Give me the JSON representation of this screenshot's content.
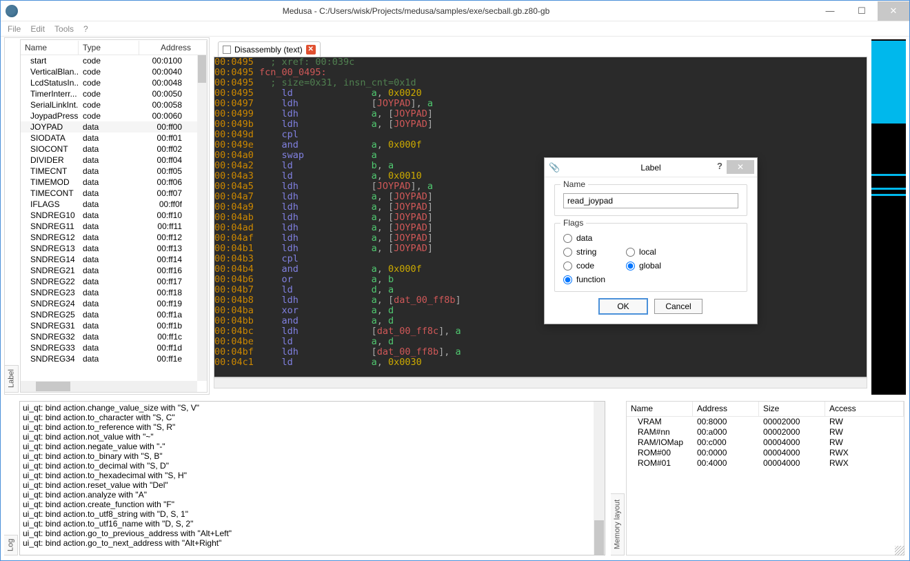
{
  "window": {
    "title": "Medusa - C:/Users/wisk/Projects/medusa/samples/exe/secball.gb.z80-gb"
  },
  "menubar": [
    "File",
    "Edit",
    "Tools",
    "?"
  ],
  "label_panel": {
    "tab_label": "Label",
    "columns": {
      "name": "Name",
      "type": "Type",
      "address": "Address"
    },
    "selected_index": 6,
    "rows": [
      {
        "name": "start",
        "type": "code",
        "addr": "00:0100"
      },
      {
        "name": "VerticalBlan..",
        "type": "code",
        "addr": "00:0040"
      },
      {
        "name": "LcdStatusIn...",
        "type": "code",
        "addr": "00:0048"
      },
      {
        "name": "TimerInterr...",
        "type": "code",
        "addr": "00:0050"
      },
      {
        "name": "SerialLinkInt...",
        "type": "code",
        "addr": "00:0058"
      },
      {
        "name": "JoypadPress...",
        "type": "code",
        "addr": "00:0060"
      },
      {
        "name": "JOYPAD",
        "type": "data",
        "addr": "00:ff00"
      },
      {
        "name": "SIODATA",
        "type": "data",
        "addr": "00:ff01"
      },
      {
        "name": "SIOCONT",
        "type": "data",
        "addr": "00:ff02"
      },
      {
        "name": "DIVIDER",
        "type": "data",
        "addr": "00:ff04"
      },
      {
        "name": "TIMECNT",
        "type": "data",
        "addr": "00:ff05"
      },
      {
        "name": "TIMEMOD",
        "type": "data",
        "addr": "00:ff06"
      },
      {
        "name": "TIMECONT",
        "type": "data",
        "addr": "00:ff07"
      },
      {
        "name": "IFLAGS",
        "type": "data",
        "addr": "00:ff0f"
      },
      {
        "name": "SNDREG10",
        "type": "data",
        "addr": "00:ff10"
      },
      {
        "name": "SNDREG11",
        "type": "data",
        "addr": "00:ff11"
      },
      {
        "name": "SNDREG12",
        "type": "data",
        "addr": "00:ff12"
      },
      {
        "name": "SNDREG13",
        "type": "data",
        "addr": "00:ff13"
      },
      {
        "name": "SNDREG14",
        "type": "data",
        "addr": "00:ff14"
      },
      {
        "name": "SNDREG21",
        "type": "data",
        "addr": "00:ff16"
      },
      {
        "name": "SNDREG22",
        "type": "data",
        "addr": "00:ff17"
      },
      {
        "name": "SNDREG23",
        "type": "data",
        "addr": "00:ff18"
      },
      {
        "name": "SNDREG24",
        "type": "data",
        "addr": "00:ff19"
      },
      {
        "name": "SNDREG25",
        "type": "data",
        "addr": "00:ff1a"
      },
      {
        "name": "SNDREG31",
        "type": "data",
        "addr": "00:ff1b"
      },
      {
        "name": "SNDREG32",
        "type": "data",
        "addr": "00:ff1c"
      },
      {
        "name": "SNDREG33",
        "type": "data",
        "addr": "00:ff1d"
      },
      {
        "name": "SNDREG34",
        "type": "data",
        "addr": "00:ff1e"
      }
    ]
  },
  "disasm_tab": {
    "label": "Disassembly (text)"
  },
  "disasm_lines": [
    [
      [
        "addr",
        "00:0495"
      ],
      [
        "pun",
        "   "
      ],
      [
        "cmt",
        "; xref: 00:039c"
      ]
    ],
    [
      [
        "addr",
        "00:0495"
      ],
      [
        "pun",
        " "
      ],
      [
        "lbl",
        "fcn_00_0495"
      ],
      [
        "lbl",
        ":"
      ]
    ],
    [
      [
        "addr",
        "00:0495"
      ],
      [
        "pun",
        "   "
      ],
      [
        "cmt",
        "; size=0x31, insn_cnt=0x1d"
      ]
    ],
    [
      [
        "addr",
        "00:0495"
      ],
      [
        "pun",
        "     "
      ],
      [
        "mne",
        "ld"
      ],
      [
        "pun",
        "              "
      ],
      [
        "reg",
        "a"
      ],
      [
        "pun",
        ", "
      ],
      [
        "imm",
        "0x0020"
      ]
    ],
    [
      [
        "addr",
        "00:0497"
      ],
      [
        "pun",
        "     "
      ],
      [
        "mne",
        "ldh"
      ],
      [
        "pun",
        "             "
      ],
      [
        "pun",
        "["
      ],
      [
        "ref",
        "JOYPAD"
      ],
      [
        "pun",
        "], "
      ],
      [
        "reg",
        "a"
      ]
    ],
    [
      [
        "addr",
        "00:0499"
      ],
      [
        "pun",
        "     "
      ],
      [
        "mne",
        "ldh"
      ],
      [
        "pun",
        "             "
      ],
      [
        "reg",
        "a"
      ],
      [
        "pun",
        ", ["
      ],
      [
        "ref",
        "JOYPAD"
      ],
      [
        "pun",
        "]"
      ]
    ],
    [
      [
        "addr",
        "00:049b"
      ],
      [
        "pun",
        "     "
      ],
      [
        "mne",
        "ldh"
      ],
      [
        "pun",
        "             "
      ],
      [
        "reg",
        "a"
      ],
      [
        "pun",
        ", ["
      ],
      [
        "ref",
        "JOYPAD"
      ],
      [
        "pun",
        "]"
      ]
    ],
    [
      [
        "addr",
        "00:049d"
      ],
      [
        "pun",
        "     "
      ],
      [
        "mne",
        "cpl"
      ]
    ],
    [
      [
        "addr",
        "00:049e"
      ],
      [
        "pun",
        "     "
      ],
      [
        "mne",
        "and"
      ],
      [
        "pun",
        "             "
      ],
      [
        "reg",
        "a"
      ],
      [
        "pun",
        ", "
      ],
      [
        "imm",
        "0x000f"
      ]
    ],
    [
      [
        "addr",
        "00:04a0"
      ],
      [
        "pun",
        "     "
      ],
      [
        "mne",
        "swap"
      ],
      [
        "pun",
        "            "
      ],
      [
        "reg",
        "a"
      ]
    ],
    [
      [
        "addr",
        "00:04a2"
      ],
      [
        "pun",
        "     "
      ],
      [
        "mne",
        "ld"
      ],
      [
        "pun",
        "              "
      ],
      [
        "reg",
        "b"
      ],
      [
        "pun",
        ", "
      ],
      [
        "reg",
        "a"
      ]
    ],
    [
      [
        "addr",
        "00:04a3"
      ],
      [
        "pun",
        "     "
      ],
      [
        "mne",
        "ld"
      ],
      [
        "pun",
        "              "
      ],
      [
        "reg",
        "a"
      ],
      [
        "pun",
        ", "
      ],
      [
        "imm",
        "0x0010"
      ]
    ],
    [
      [
        "addr",
        "00:04a5"
      ],
      [
        "pun",
        "     "
      ],
      [
        "mne",
        "ldh"
      ],
      [
        "pun",
        "             "
      ],
      [
        "pun",
        "["
      ],
      [
        "ref",
        "JOYPAD"
      ],
      [
        "pun",
        "], "
      ],
      [
        "reg",
        "a"
      ]
    ],
    [
      [
        "addr",
        "00:04a7"
      ],
      [
        "pun",
        "     "
      ],
      [
        "mne",
        "ldh"
      ],
      [
        "pun",
        "             "
      ],
      [
        "reg",
        "a"
      ],
      [
        "pun",
        ", ["
      ],
      [
        "ref",
        "JOYPAD"
      ],
      [
        "pun",
        "]"
      ]
    ],
    [
      [
        "addr",
        "00:04a9"
      ],
      [
        "pun",
        "     "
      ],
      [
        "mne",
        "ldh"
      ],
      [
        "pun",
        "             "
      ],
      [
        "reg",
        "a"
      ],
      [
        "pun",
        ", ["
      ],
      [
        "ref",
        "JOYPAD"
      ],
      [
        "pun",
        "]"
      ]
    ],
    [
      [
        "addr",
        "00:04ab"
      ],
      [
        "pun",
        "     "
      ],
      [
        "mne",
        "ldh"
      ],
      [
        "pun",
        "             "
      ],
      [
        "reg",
        "a"
      ],
      [
        "pun",
        ", ["
      ],
      [
        "ref",
        "JOYPAD"
      ],
      [
        "pun",
        "]"
      ]
    ],
    [
      [
        "addr",
        "00:04ad"
      ],
      [
        "pun",
        "     "
      ],
      [
        "mne",
        "ldh"
      ],
      [
        "pun",
        "             "
      ],
      [
        "reg",
        "a"
      ],
      [
        "pun",
        ", ["
      ],
      [
        "ref",
        "JOYPAD"
      ],
      [
        "pun",
        "]"
      ]
    ],
    [
      [
        "addr",
        "00:04af"
      ],
      [
        "pun",
        "     "
      ],
      [
        "mne",
        "ldh"
      ],
      [
        "pun",
        "             "
      ],
      [
        "reg",
        "a"
      ],
      [
        "pun",
        ", ["
      ],
      [
        "ref",
        "JOYPAD"
      ],
      [
        "pun",
        "]"
      ]
    ],
    [
      [
        "addr",
        "00:04b1"
      ],
      [
        "pun",
        "     "
      ],
      [
        "mne",
        "ldh"
      ],
      [
        "pun",
        "             "
      ],
      [
        "reg",
        "a"
      ],
      [
        "pun",
        ", ["
      ],
      [
        "ref",
        "JOYPAD"
      ],
      [
        "pun",
        "]"
      ]
    ],
    [
      [
        "addr",
        "00:04b3"
      ],
      [
        "pun",
        "     "
      ],
      [
        "mne",
        "cpl"
      ]
    ],
    [
      [
        "addr",
        "00:04b4"
      ],
      [
        "pun",
        "     "
      ],
      [
        "mne",
        "and"
      ],
      [
        "pun",
        "             "
      ],
      [
        "reg",
        "a"
      ],
      [
        "pun",
        ", "
      ],
      [
        "imm",
        "0x000f"
      ]
    ],
    [
      [
        "addr",
        "00:04b6"
      ],
      [
        "pun",
        "     "
      ],
      [
        "mne",
        "or"
      ],
      [
        "pun",
        "              "
      ],
      [
        "reg",
        "a"
      ],
      [
        "pun",
        ", "
      ],
      [
        "reg",
        "b"
      ]
    ],
    [
      [
        "addr",
        "00:04b7"
      ],
      [
        "pun",
        "     "
      ],
      [
        "mne",
        "ld"
      ],
      [
        "pun",
        "              "
      ],
      [
        "reg",
        "d"
      ],
      [
        "pun",
        ", "
      ],
      [
        "reg",
        "a"
      ]
    ],
    [
      [
        "addr",
        "00:04b8"
      ],
      [
        "pun",
        "     "
      ],
      [
        "mne",
        "ldh"
      ],
      [
        "pun",
        "             "
      ],
      [
        "reg",
        "a"
      ],
      [
        "pun",
        ", ["
      ],
      [
        "ref",
        "dat_00_ff8b"
      ],
      [
        "pun",
        "]"
      ]
    ],
    [
      [
        "addr",
        "00:04ba"
      ],
      [
        "pun",
        "     "
      ],
      [
        "mne",
        "xor"
      ],
      [
        "pun",
        "             "
      ],
      [
        "reg",
        "a"
      ],
      [
        "pun",
        ", "
      ],
      [
        "reg",
        "d"
      ]
    ],
    [
      [
        "addr",
        "00:04bb"
      ],
      [
        "pun",
        "     "
      ],
      [
        "mne",
        "and"
      ],
      [
        "pun",
        "             "
      ],
      [
        "reg",
        "a"
      ],
      [
        "pun",
        ", "
      ],
      [
        "reg",
        "d"
      ]
    ],
    [
      [
        "addr",
        "00:04bc"
      ],
      [
        "pun",
        "     "
      ],
      [
        "mne",
        "ldh"
      ],
      [
        "pun",
        "             "
      ],
      [
        "pun",
        "["
      ],
      [
        "ref",
        "dat_00_ff8c"
      ],
      [
        "pun",
        "], "
      ],
      [
        "reg",
        "a"
      ]
    ],
    [
      [
        "addr",
        "00:04be"
      ],
      [
        "pun",
        "     "
      ],
      [
        "mne",
        "ld"
      ],
      [
        "pun",
        "              "
      ],
      [
        "reg",
        "a"
      ],
      [
        "pun",
        ", "
      ],
      [
        "reg",
        "d"
      ]
    ],
    [
      [
        "addr",
        "00:04bf"
      ],
      [
        "pun",
        "     "
      ],
      [
        "mne",
        "ldh"
      ],
      [
        "pun",
        "             "
      ],
      [
        "pun",
        "["
      ],
      [
        "ref",
        "dat_00_ff8b"
      ],
      [
        "pun",
        "], "
      ],
      [
        "reg",
        "a"
      ]
    ],
    [
      [
        "addr",
        "00:04c1"
      ],
      [
        "pun",
        "     "
      ],
      [
        "mne",
        "ld"
      ],
      [
        "pun",
        "              "
      ],
      [
        "reg",
        "a"
      ],
      [
        "pun",
        ", "
      ],
      [
        "imm",
        "0x0030"
      ]
    ]
  ],
  "log": {
    "tab_label": "Log",
    "lines": [
      "ui_qt: bind action.change_value_size with \"S, V\"",
      "ui_qt: bind action.to_character with \"S, C\"",
      "ui_qt: bind action.to_reference with \"S, R\"",
      "ui_qt: bind action.not_value with \"~\"",
      "ui_qt: bind action.negate_value with \"-\"",
      "ui_qt: bind action.to_binary with \"S, B\"",
      "ui_qt: bind action.to_decimal with \"S, D\"",
      "ui_qt: bind action.to_hexadecimal with \"S, H\"",
      "ui_qt: bind action.reset_value with \"Del\"",
      "ui_qt: bind action.analyze with \"A\"",
      "ui_qt: bind action.create_function with \"F\"",
      "ui_qt: bind action.to_utf8_string with \"D, S, 1\"",
      "ui_qt: bind action.to_utf16_name with \"D, S, 2\"",
      "ui_qt: bind action.go_to_previous_address with \"Alt+Left\"",
      "ui_qt: bind action.go_to_next_address with \"Alt+Right\""
    ]
  },
  "memory": {
    "tab_label": "Memory layout",
    "columns": {
      "name": "Name",
      "address": "Address",
      "size": "Size",
      "access": "Access"
    },
    "rows": [
      {
        "name": "VRAM",
        "addr": "00:8000",
        "size": "00002000",
        "access": "RW"
      },
      {
        "name": "RAM#nn",
        "addr": "00:a000",
        "size": "00002000",
        "access": "RW"
      },
      {
        "name": "RAM/IOMap",
        "addr": "00:c000",
        "size": "00004000",
        "access": "RW"
      },
      {
        "name": "ROM#00",
        "addr": "00:0000",
        "size": "00004000",
        "access": "RWX"
      },
      {
        "name": "ROM#01",
        "addr": "00:4000",
        "size": "00004000",
        "access": "RWX"
      }
    ]
  },
  "dialog": {
    "title": "Label",
    "name_group": "Name",
    "name_value": "read_joypad",
    "flags_group": "Flags",
    "flags_left": [
      {
        "label": "data",
        "checked": false
      },
      {
        "label": "string",
        "checked": false
      },
      {
        "label": "code",
        "checked": false
      },
      {
        "label": "function",
        "checked": true
      }
    ],
    "flags_right": [
      {
        "label": "local",
        "checked": false
      },
      {
        "label": "global",
        "checked": true
      }
    ],
    "ok": "OK",
    "cancel": "Cancel"
  }
}
